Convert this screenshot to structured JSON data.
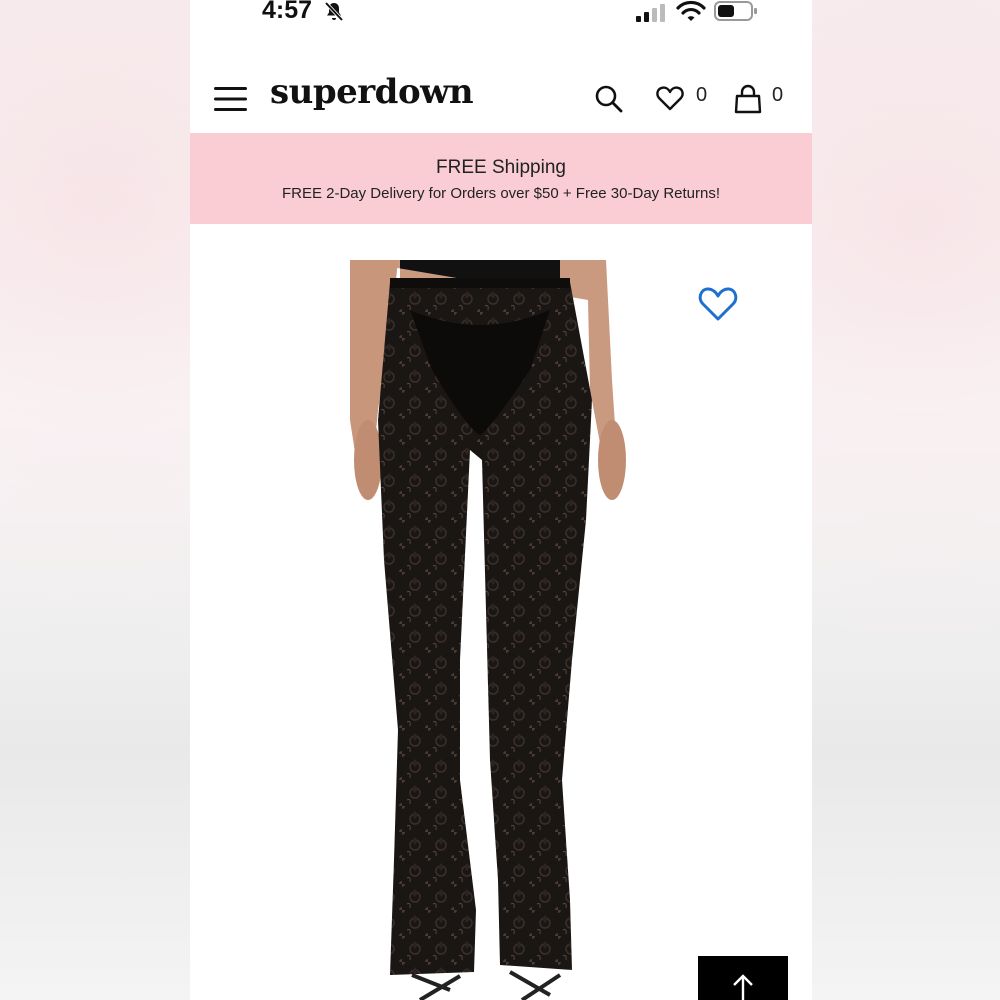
{
  "status_bar": {
    "time": "4:57",
    "icons": [
      "bell-off-icon",
      "signal-icon",
      "wifi-icon",
      "battery-icon"
    ]
  },
  "header": {
    "logo": "superdown",
    "icons": [
      "menu-icon",
      "search-icon",
      "heart-icon",
      "bag-icon"
    ],
    "wishlist_count": "0",
    "bag_count": "0"
  },
  "banner": {
    "title": "FREE Shipping",
    "subtitle": "FREE 2-Day Delivery for Orders over $50 + Free 30-Day Returns!",
    "background": "#f9cdd3"
  },
  "product": {
    "favorite_icon": "heart-outline-icon",
    "favorite_color": "#1f6fd1"
  },
  "scroll_top": {
    "icon": "arrow-up-icon"
  }
}
